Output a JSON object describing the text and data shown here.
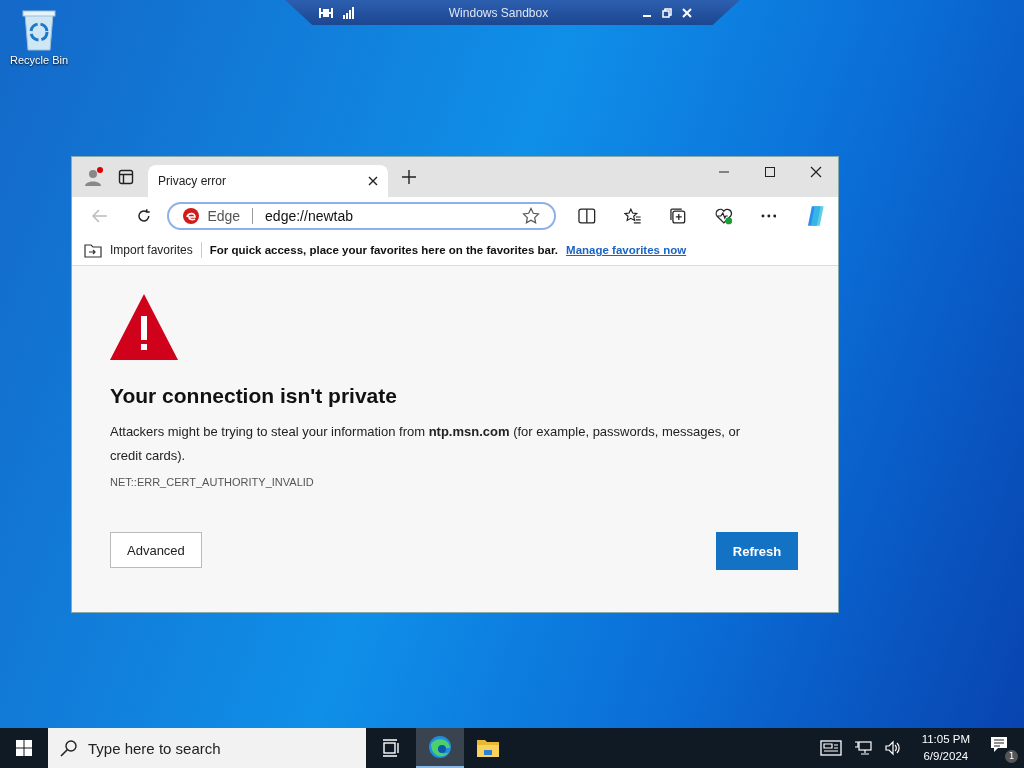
{
  "desktop": {
    "icons": [
      {
        "label": "Recycle Bin"
      }
    ]
  },
  "sandbox_bar": {
    "title": "Windows Sandbox"
  },
  "browser": {
    "tabs": [
      {
        "title": "Privacy error",
        "selected": true
      }
    ],
    "address_bar": {
      "site_label": "Edge",
      "value": "edge://newtab"
    },
    "favorites_bar": {
      "import_label": "Import favorites",
      "message": "For quick access, place your favorites here on the favorites bar.",
      "link": "Manage favorites now"
    },
    "page": {
      "heading": "Your connection isn't private",
      "description": "Attackers might be trying to steal your information from **ntp.msn.com** (for example, passwords, messages, or credit cards).",
      "error_code": "NET::ERR_CERT_AUTHORITY_INVALID",
      "buttons": [
        {
          "label": "Advanced",
          "kind": "secondary"
        },
        {
          "label": "Refresh",
          "kind": "primary"
        }
      ]
    }
  },
  "taskbar": {
    "search": {
      "placeholder": "Type here to search"
    },
    "apps": [
      {
        "kind": "edge",
        "active": true
      },
      {
        "kind": "explorer",
        "active": false
      }
    ],
    "time": "11:05 PM",
    "date": "6/9/2024",
    "notification_count": "1"
  }
}
